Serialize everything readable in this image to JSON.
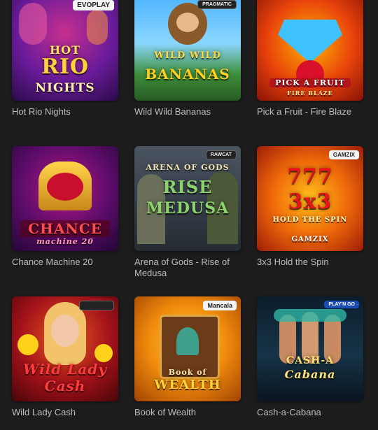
{
  "games": [
    {
      "title": "Hot Rio Nights",
      "provider": "EVOPLAY",
      "art": [
        "HOT",
        "RIO",
        "NIGHTS"
      ]
    },
    {
      "title": "Wild Wild Bananas",
      "provider": "PRAGMATIC",
      "art": [
        "WILD WILD",
        "BANANAS"
      ]
    },
    {
      "title": "Pick a Fruit - Fire Blaze",
      "provider": "",
      "art": [
        "PICK A FRUIT",
        "FIRE BLAZE"
      ]
    },
    {
      "title": "Chance Machine 20",
      "provider": "",
      "art": [
        "CHANCE",
        "machine 20"
      ]
    },
    {
      "title": "Arena of Gods - Rise of Medusa",
      "provider": "RAWCAT",
      "art": [
        "ARENA OF GODS",
        "RISE",
        "MEDUSA"
      ]
    },
    {
      "title": "3x3 Hold the Spin",
      "provider": "GAMZIX",
      "art": [
        "777",
        "3x3",
        "HOLD THE SPIN",
        "GAMZIX"
      ]
    },
    {
      "title": "Wild Lady Cash",
      "provider": "",
      "art": [
        "Wild Lady",
        "Cash"
      ]
    },
    {
      "title": "Book of Wealth",
      "provider": "Mancala",
      "art": [
        "Book of",
        "WEALTH"
      ]
    },
    {
      "title": "Cash-a-Cabana",
      "provider": "PLAY'N GO",
      "art": [
        "CASH-A",
        "Cabana"
      ]
    }
  ]
}
